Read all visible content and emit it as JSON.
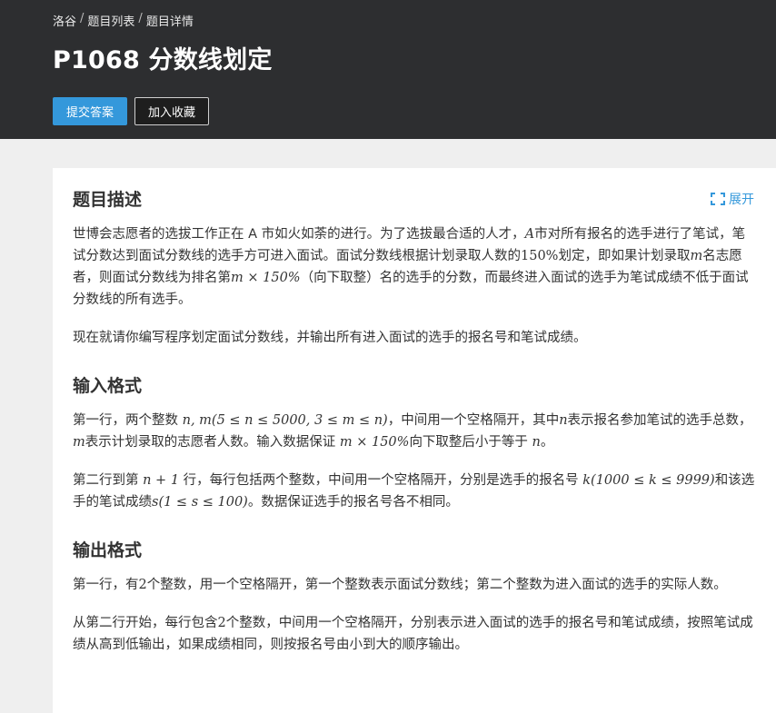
{
  "breadcrumb": {
    "items": [
      "洛谷",
      "题目列表",
      "题目详情"
    ],
    "sep": "/"
  },
  "header": {
    "title": "P1068 分数线划定",
    "submit_label": "提交答案",
    "favorite_label": "加入收藏"
  },
  "card": {
    "expand_label": "展开",
    "desc": {
      "heading": "题目描述",
      "p1": {
        "t1": "世博会志愿者的选拔工作正在 A 市如火如荼的进行。为了选拔最合适的人才，",
        "m1": "A",
        "t2": "市对所有报名的选手进行了笔试，笔试分数达到面试分数线的选手方可进入面试。面试分数线根据计划录取人数的",
        "m2": "150%",
        "t3": "划定，即如果计划录取",
        "m3": "m",
        "t4": "名志愿者，则面试分数线为排名第",
        "m4": "m × 150%",
        "t5": "（向下取整）名的选手的分数，而最终进入面试的选手为笔试成绩不低于面试分数线的所有选手。"
      },
      "p2": "现在就请你编写程序划定面试分数线，并输出所有进入面试的选手的报名号和笔试成绩。"
    },
    "input": {
      "heading": "输入格式",
      "p1": {
        "t1": "第一行，两个整数 ",
        "m1": "n, m(5 ≤ n ≤ 5000, 3 ≤ m ≤ n)",
        "t2": "，中间用一个空格隔开，其中",
        "m2": "n",
        "t3": "表示报名参加笔试的选手总数，",
        "m3": "m",
        "t4": "表示计划录取的志愿者人数。输入数据保证 ",
        "m4": "m × 150%",
        "t5": "向下取整后小于等于 ",
        "m5": "n",
        "t6": "。"
      },
      "p2": {
        "t1": "第二行到第 ",
        "m1": "n + 1",
        "t2": " 行，每行包括两个整数，中间用一个空格隔开，分别是选手的报名号 ",
        "m2": "k(1000 ≤ k ≤ 9999)",
        "t3": "和该选手的笔试成绩",
        "m3": "s(1 ≤ s ≤ 100)",
        "t4": "。数据保证选手的报名号各不相同。"
      }
    },
    "output": {
      "heading": "输出格式",
      "p1": {
        "t1": "第一行，有",
        "m1": "2",
        "t2": "个整数，用一个空格隔开，第一个整数表示面试分数线；第二个整数为进入面试的选手的实际人数。"
      },
      "p2": {
        "t1": "从第二行开始，每行包含",
        "m1": "2",
        "t2": "个整数，中间用一个空格隔开，分别表示进入面试的选手的报名号和笔试成绩，按照笔试成绩从高到低输出，如果成绩相同，则按报名号由小到大的顺序输出。"
      }
    }
  },
  "colors": {
    "header_bg": "#2d2e30",
    "primary": "#3498db",
    "page_bg": "#efefef"
  }
}
